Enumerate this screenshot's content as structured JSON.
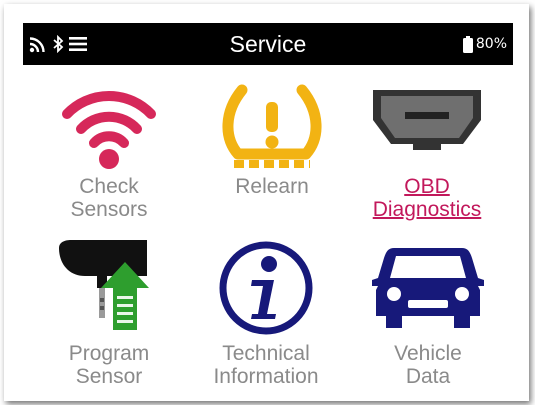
{
  "status_bar": {
    "title": "Service",
    "battery_percent": "80%",
    "icons": [
      "wifi-signal-icon",
      "bluetooth-icon",
      "menu-icon",
      "battery-icon"
    ]
  },
  "tiles": [
    {
      "label": "Check\nSensors",
      "icon": "wifi-sensor-icon",
      "color": "#d6285a"
    },
    {
      "label": "Relearn",
      "icon": "tire-pressure-warning-icon",
      "color": "#f2b313"
    },
    {
      "label": "OBD\nDiagnostics",
      "icon": "obd-connector-icon",
      "color": "#c2185b",
      "link": true
    },
    {
      "label": "Program\nSensor",
      "icon": "program-sensor-icon",
      "color": "#2e9e2e"
    },
    {
      "label": "Technical\nInformation",
      "icon": "info-icon",
      "color": "#17197a"
    },
    {
      "label": "Vehicle\nData",
      "icon": "car-icon",
      "color": "#17197a"
    }
  ],
  "colors": {
    "statusbar_bg": "#000000",
    "label_gray": "#8a8a8a",
    "accent": "#c2185b"
  }
}
